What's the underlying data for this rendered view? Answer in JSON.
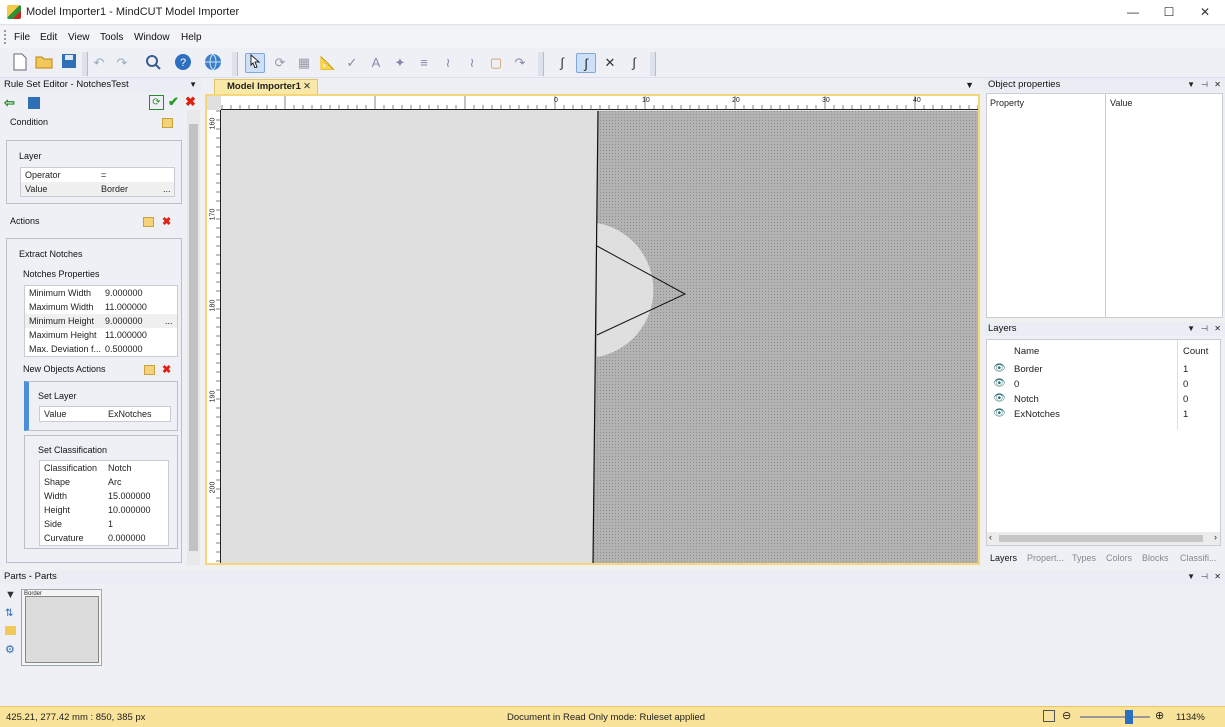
{
  "window": {
    "title": "Model Importer1 - MindCUT Model Importer",
    "minimize": "—",
    "maximize": "☐",
    "close": "✕"
  },
  "menu": [
    "File",
    "Edit",
    "View",
    "Tools",
    "Window",
    "Help"
  ],
  "rule_editor": {
    "title": "Rule Set Editor - NotchesTest",
    "condition_label": "Condition",
    "condition_group_title": "Layer",
    "condition_rows": [
      {
        "key": "Operator",
        "value": "="
      },
      {
        "key": "Value",
        "value": "Border"
      }
    ],
    "ellipsis": "...",
    "actions_label": "Actions",
    "extract_title": "Extract Notches",
    "notches_props_title": "Notches Properties",
    "notches_rows": [
      {
        "key": "Minimum Width",
        "value": "9.000000"
      },
      {
        "key": "Maximum Width",
        "value": "11.000000"
      },
      {
        "key": "Minimum Height",
        "value": "9.000000"
      },
      {
        "key": "Maximum Height",
        "value": "11.000000"
      },
      {
        "key": "Max. Deviation f...",
        "value": "0.500000"
      }
    ],
    "new_objects_label": "New Objects Actions",
    "set_layer_title": "Set Layer",
    "set_layer_rows": [
      {
        "key": "Value",
        "value": "ExNotches"
      }
    ],
    "set_class_title": "Set Classification",
    "set_class_rows": [
      {
        "key": "Classification",
        "value": "Notch"
      },
      {
        "key": "Shape",
        "value": "Arc"
      },
      {
        "key": "Width",
        "value": "15.000000"
      },
      {
        "key": "Height",
        "value": "10.000000"
      },
      {
        "key": "Side",
        "value": "1"
      },
      {
        "key": "Curvature",
        "value": "0.000000"
      }
    ]
  },
  "document": {
    "tab_label": "Model Importer1",
    "hruler_labels": [
      "0",
      "10",
      "20",
      "30",
      "40"
    ],
    "vruler_labels": [
      "160",
      "170",
      "180",
      "190",
      "200"
    ]
  },
  "object_properties": {
    "title": "Object properties",
    "col_property": "Property",
    "col_value": "Value"
  },
  "layers": {
    "title": "Layers",
    "col_name": "Name",
    "col_count": "Count",
    "rows": [
      {
        "name": "Border",
        "count": "1"
      },
      {
        "name": "0",
        "count": "0"
      },
      {
        "name": "Notch",
        "count": "0"
      },
      {
        "name": "ExNotches",
        "count": "1"
      }
    ],
    "tabs": [
      "Layers",
      "Propert...",
      "Types",
      "Colors",
      "Blocks",
      "Classifi..."
    ]
  },
  "parts": {
    "title": "Parts - Parts",
    "thumb_label": "Border"
  },
  "status": {
    "coords": "425.21, 277.42 mm : 850, 385 px",
    "message": "Document in Read Only mode: Ruleset applied",
    "zoom": "1134%"
  },
  "colors": {
    "accent": "#f5d67a",
    "status_bg": "#f9e39a",
    "selection": "#cde0f7"
  }
}
